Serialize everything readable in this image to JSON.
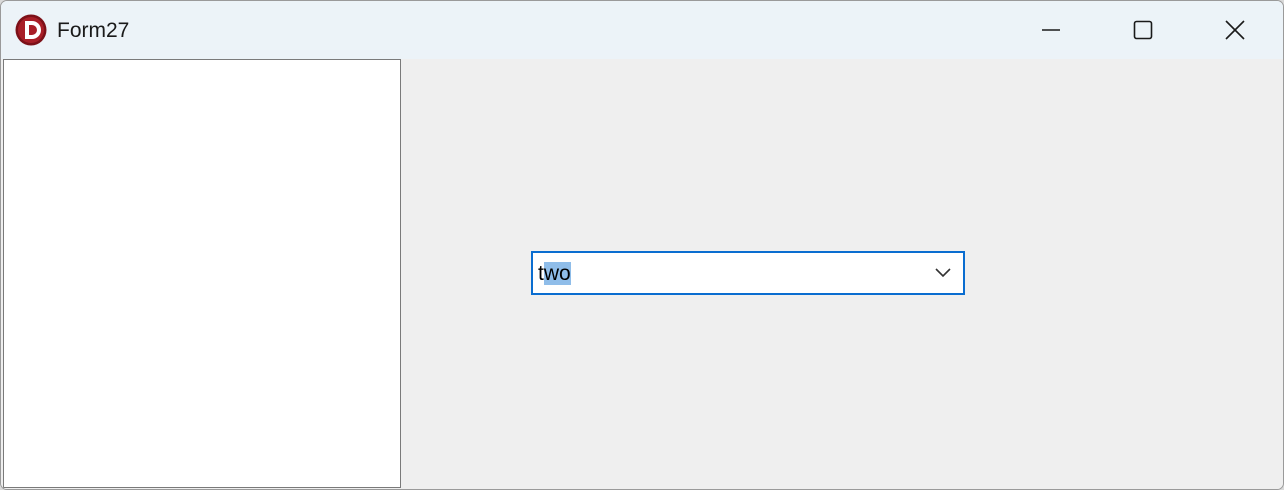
{
  "window": {
    "title": "Form27"
  },
  "combo": {
    "text_prefix": "t",
    "text_selected": "wo"
  },
  "colors": {
    "titlebar_bg": "#ecf3f8",
    "client_bg": "#efefef",
    "accent": "#0a6dd0",
    "selection": "#8fbde9",
    "icon_red": "#9b1b22"
  },
  "icons": {
    "app": "delphi-logo-icon",
    "minimize": "minimize-icon",
    "maximize": "maximize-icon",
    "close": "close-icon",
    "dropdown": "chevron-down-icon"
  }
}
